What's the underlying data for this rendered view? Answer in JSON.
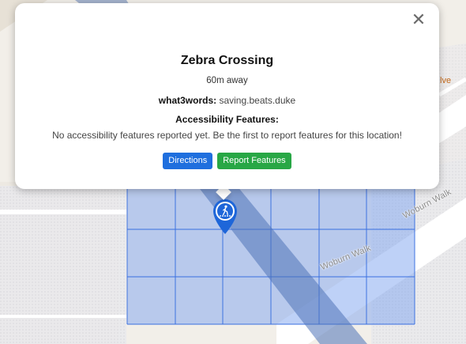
{
  "popup": {
    "title": "Zebra Crossing",
    "distance": "60m away",
    "w3w_label": "what3words:",
    "w3w_value": "saving.beats.duke",
    "accessibility_heading": "Accessibility Features:",
    "accessibility_text": "No accessibility features reported yet. Be the first to report features for this location!",
    "close_symbol": "✕",
    "buttons": {
      "directions": "Directions",
      "report": "Report Features"
    }
  },
  "map": {
    "street_labels": [
      "Woburn Walk",
      "Woburn Walk"
    ],
    "poi_label_fragment": "lve",
    "marker_icon": "pedestrian-crossing-icon"
  },
  "colors": {
    "grid_fill": "#7ea3f0",
    "grid_line": "#3a6fe0",
    "marker": "#1e66d9",
    "directions_button": "#1f6fde",
    "report_button": "#28a745"
  }
}
